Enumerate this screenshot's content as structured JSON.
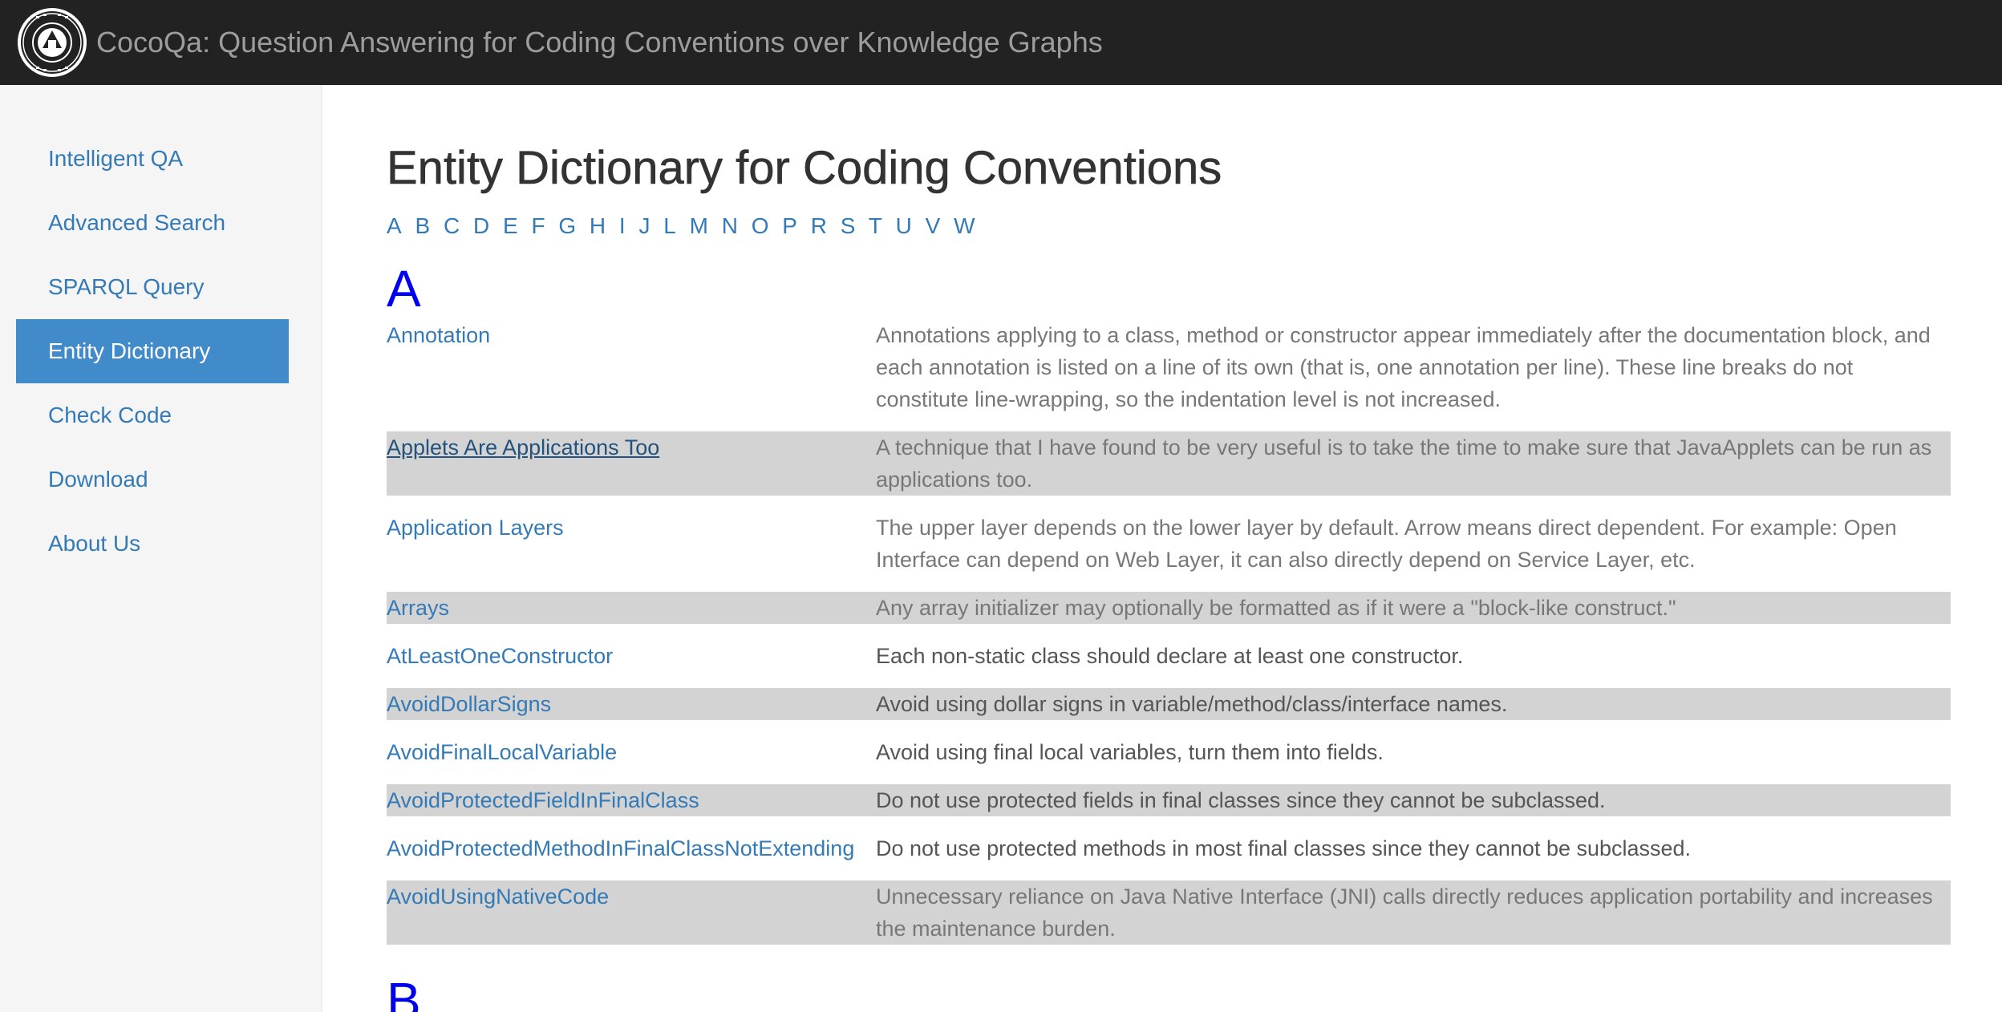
{
  "header": {
    "title": "CocoQa: Question Answering for Coding Conventions over Knowledge Graphs",
    "logo_icon": "university-seal-icon"
  },
  "sidebar": {
    "items": [
      {
        "label": "Intelligent QA",
        "active": false
      },
      {
        "label": "Advanced Search",
        "active": false
      },
      {
        "label": "SPARQL Query",
        "active": false
      },
      {
        "label": "Entity Dictionary",
        "active": true
      },
      {
        "label": "Check Code",
        "active": false
      },
      {
        "label": "Download",
        "active": false
      },
      {
        "label": "About Us",
        "active": false
      }
    ]
  },
  "main": {
    "title": "Entity Dictionary for Coding Conventions",
    "alphabet": [
      "A",
      "B",
      "C",
      "D",
      "E",
      "F",
      "G",
      "H",
      "I",
      "J",
      "L",
      "M",
      "N",
      "O",
      "P",
      "R",
      "S",
      "T",
      "U",
      "V",
      "W"
    ],
    "sections": [
      {
        "letter": "A",
        "entries": [
          {
            "term": "Annotation",
            "desc": "Annotations applying to a class, method or constructor appear immediately after the documentation block, and each annotation is listed on a line of its own (that is, one annotation per line). These line breaks do not constitute line-wrapping, so the indentation level is not increased."
          },
          {
            "term": "Applets Are Applications Too",
            "desc": "A technique that I have found to be very useful is to take the time to make sure that JavaApplets can be run as applications too."
          },
          {
            "term": "Application Layers",
            "desc": "The upper layer depends on the lower layer by default. Arrow means direct dependent. For example: Open Interface can depend on Web Layer, it can also directly depend on Service Layer, etc."
          },
          {
            "term": "Arrays",
            "desc": "Any array initializer may optionally be formatted as if it were a \"block-like construct.\""
          },
          {
            "term": "AtLeastOneConstructor",
            "desc": "Each non-static class should declare at least one constructor."
          },
          {
            "term": "AvoidDollarSigns",
            "desc": "Avoid using dollar signs in variable/method/class/interface names."
          },
          {
            "term": "AvoidFinalLocalVariable",
            "desc": "Avoid using final local variables, turn them into fields."
          },
          {
            "term": "AvoidProtectedFieldInFinalClass",
            "desc": "Do not use protected fields in final classes since they cannot be subclassed."
          },
          {
            "term": "AvoidProtectedMethodInFinalClassNotExtending",
            "desc": "Do not use protected methods in most final classes since they cannot be subclassed."
          },
          {
            "term": "AvoidUsingNativeCode",
            "desc": "Unnecessary reliance on Java Native Interface (JNI) calls directly reduces application portability and increases the maintenance burden."
          }
        ]
      },
      {
        "letter": "B",
        "entries": []
      }
    ]
  },
  "colors": {
    "navbar": "#222222",
    "link": "#337ab7",
    "active_nav": "#428bca",
    "letter_heading": "#0000ee",
    "alt_row": "#d3d3d3"
  }
}
